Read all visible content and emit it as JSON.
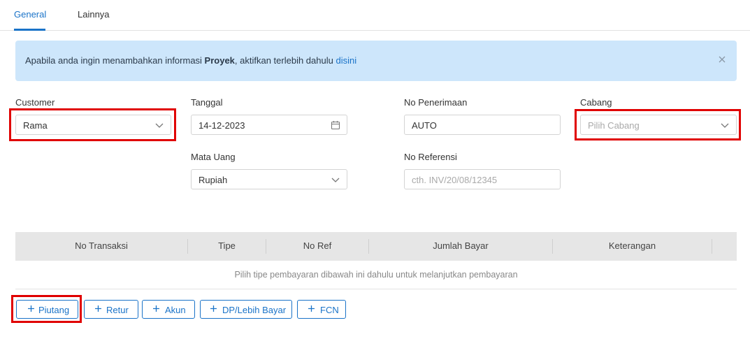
{
  "tabs": [
    {
      "label": "General",
      "active": true
    },
    {
      "label": "Lainnya",
      "active": false
    }
  ],
  "alert": {
    "text_before": "Apabila anda ingin menambahkan informasi ",
    "bold": "Proyek",
    "text_after": ", aktifkan terlebih dahulu ",
    "link": "disini"
  },
  "form": {
    "customer": {
      "label": "Customer",
      "value": "Rama"
    },
    "tanggal": {
      "label": "Tanggal",
      "value": "14-12-2023"
    },
    "no_penerimaan": {
      "label": "No Penerimaan",
      "value": "AUTO"
    },
    "cabang": {
      "label": "Cabang",
      "placeholder": "Pilih Cabang"
    },
    "mata_uang": {
      "label": "Mata Uang",
      "value": "Rupiah"
    },
    "no_referensi": {
      "label": "No Referensi",
      "placeholder": "cth. INV/20/08/12345"
    }
  },
  "table": {
    "columns": [
      "No Transaksi",
      "Tipe",
      "No Ref",
      "Jumlah Bayar",
      "Keterangan"
    ],
    "empty_text": "Pilih tipe pembayaran dibawah ini dahulu untuk melanjutkan pembayaran"
  },
  "buttons": {
    "piutang": "Piutang",
    "retur": "Retur",
    "akun": "Akun",
    "dp": "DP/Lebih Bayar",
    "fcn": "FCN"
  },
  "colors": {
    "accent": "#1a73c8",
    "alert_bg": "#cde6fb",
    "highlight": "#e00000"
  }
}
